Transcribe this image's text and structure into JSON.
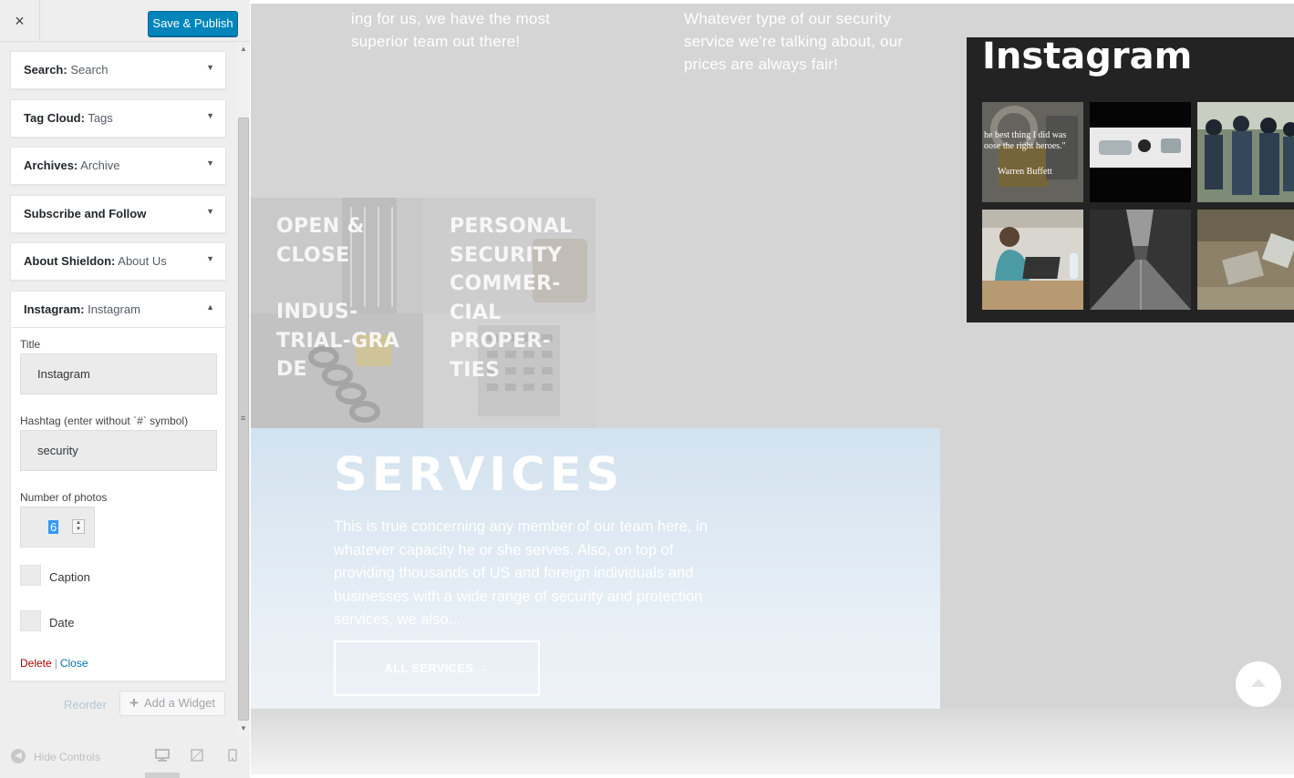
{
  "header": {
    "close_icon": "×",
    "publish_label": "Save & Publish"
  },
  "colors": {
    "publish_button": "#0085ba",
    "delete_link": "#aa0000",
    "close_link": "#0073aa",
    "instagram_panel": "#232323",
    "services_panel": "#d2e2ef"
  },
  "widgets": [
    {
      "type": "Search:",
      "title": "Search"
    },
    {
      "type": "Tag Cloud:",
      "title": "Tags"
    },
    {
      "type": "Archives:",
      "title": "Archive"
    },
    {
      "type": "Subscribe and Follow",
      "title": ""
    },
    {
      "type": "About Shieldon:",
      "title": "About Us"
    },
    {
      "type": "Instagram:",
      "title": "Instagram"
    }
  ],
  "instagram_form": {
    "title_label": "Title",
    "title_value": "Instagram",
    "hashtag_label": "Hashtag (enter without `#` symbol)",
    "hashtag_value": "security",
    "photos_label": "Number of photos",
    "photos_value": "6",
    "caption_label": "Caption",
    "date_label": "Date",
    "delete_label": "Delete",
    "separator": "|",
    "close_label": "Close"
  },
  "sidebar_footer": {
    "reorder_label": "Reorder",
    "add_widget_label": "Add a Widget",
    "hide_controls_label": "Hide Controls",
    "devices": [
      "desktop-icon",
      "tablet-icon",
      "mobile-icon"
    ]
  },
  "preview": {
    "text_col1": "ing for us, we have the most superior team out there!",
    "text_col2": "Whatever type of our security service we're talking about, our prices are always fair!",
    "instagram_title": "Instagram",
    "photo_quote": "he best thing I did was oose the right heroes.\"",
    "photo_author": "Warren Buffett",
    "tiles": [
      "OPEN & CLOSE",
      "PERSONAL SECURITY COMMER-CIAL PROPER-TIES",
      "INDUS-TRIAL-GRA DE"
    ],
    "services_title": "SERVICES",
    "services_text": "This is true concerning any member of our team here, in whatever capacity he or she serves. Also, on top of providing thousands of US and foreign individuals and businesses with a wide range of security and protection services, we also...",
    "all_services_label": "ALL SERVICES →"
  }
}
